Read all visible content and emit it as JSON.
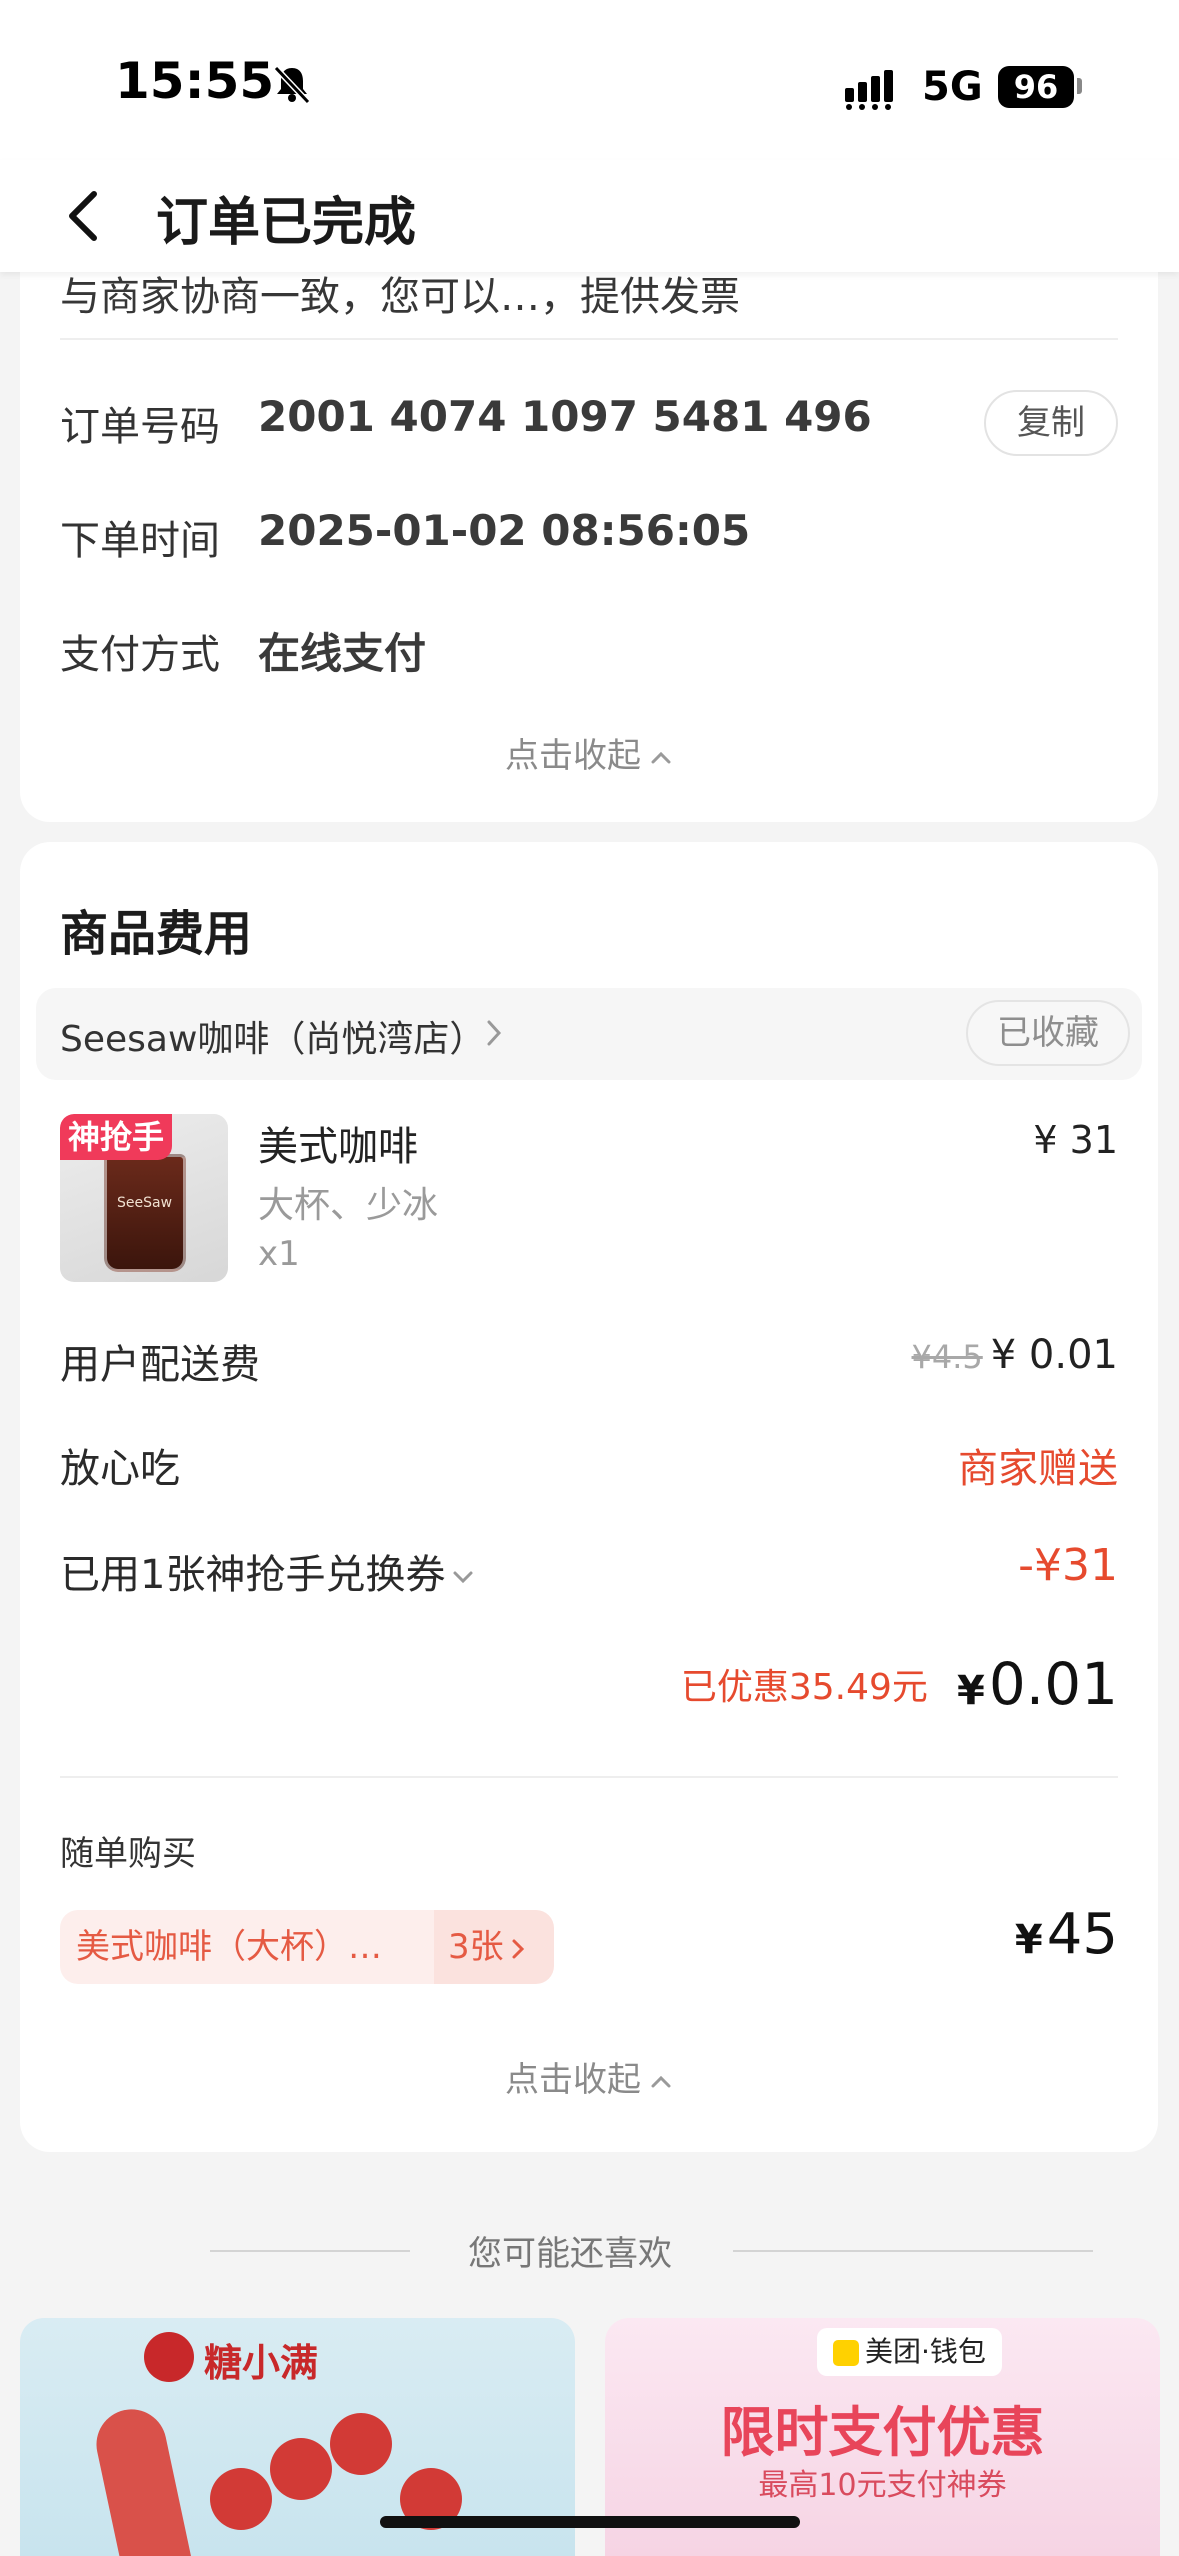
{
  "status_bar": {
    "time": "15:55",
    "network": "5G",
    "battery": "96"
  },
  "nav": {
    "title": "订单已完成"
  },
  "order_info": {
    "cut_text": "与商家协商一致，您可以…，提供发票",
    "order_no_label": "订单号码",
    "order_no": "2001 4074 1097 5481 496",
    "copy_label": "复制",
    "order_time_label": "下单时间",
    "order_time": "2025-01-02 08:56:05",
    "pay_label": "支付方式",
    "pay_value": "在线支付",
    "collapse_label": "点击收起"
  },
  "fees": {
    "section_title": "商品费用",
    "store_name": "Seesaw咖啡（尚悦湾店）",
    "fav_label": "已收藏",
    "product": {
      "badge": "神抢手",
      "name": "美式咖啡",
      "spec": "大杯、少冰",
      "qty": "x1",
      "price": "¥ 31",
      "cup_text": "SeeSaw"
    },
    "delivery_label": "用户配送费",
    "delivery_orig": "¥4.5",
    "delivery_price": "¥ 0.01",
    "assurance_label": "放心吃",
    "assurance_value": "商家赠送",
    "coupon_label": "已用1张神抢手兑换券",
    "coupon_value": "-¥31",
    "discount_text": "已优惠35.49元",
    "total_yen": "¥",
    "total_value": "0.01",
    "addon_title": "随单购买",
    "addon_item": "美式咖啡（大杯）…",
    "addon_count": "3张",
    "addon_yen": "¥",
    "addon_price": "45",
    "collapse_label": "点击收起"
  },
  "recommend": {
    "title": "您可能还喜欢",
    "promo1_brand": "糖小满",
    "promo2_tag": "美团·钱包",
    "promo2_title": "限时支付优惠",
    "promo2_sub": "最高10元支付神券"
  },
  "colors": {
    "accent_red": "#e64a2e",
    "badge_pink": "#f03a5a",
    "page_bg": "#f4f4f4"
  }
}
